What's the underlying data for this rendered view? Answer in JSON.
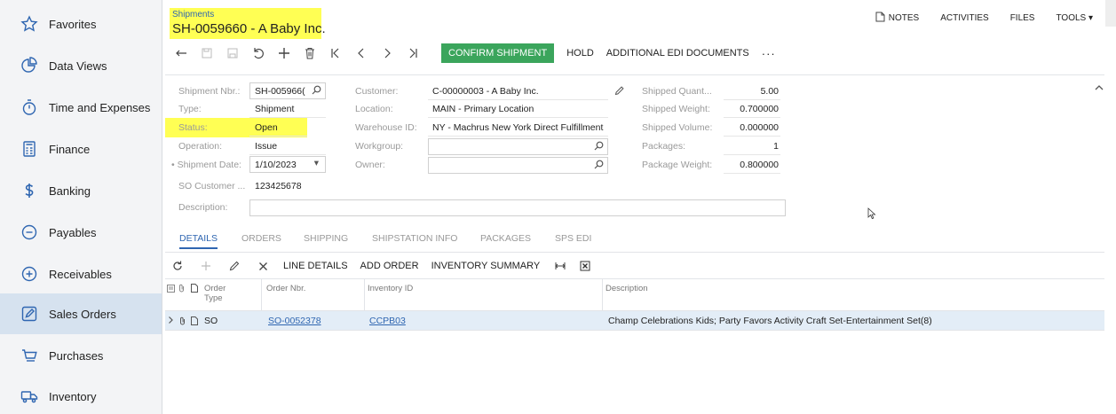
{
  "sidebar": {
    "items": [
      {
        "label": "Favorites",
        "icon": "star-icon"
      },
      {
        "label": "Data Views",
        "icon": "pie-chart-icon"
      },
      {
        "label": "Time and Expenses",
        "icon": "stopwatch-icon"
      },
      {
        "label": "Finance",
        "icon": "calculator-icon"
      },
      {
        "label": "Banking",
        "icon": "dollar-icon"
      },
      {
        "label": "Payables",
        "icon": "minus-circle-icon"
      },
      {
        "label": "Receivables",
        "icon": "plus-circle-icon"
      },
      {
        "label": "Sales Orders",
        "icon": "pencil-square-icon"
      },
      {
        "label": "Purchases",
        "icon": "cart-icon"
      },
      {
        "label": "Inventory",
        "icon": "truck-icon"
      }
    ],
    "active": "Sales Orders"
  },
  "header": {
    "breadcrumb": "Shipments",
    "title": "SH-0059660 - A Baby Inc.",
    "actions": {
      "notes": "NOTES",
      "activities": "ACTIVITIES",
      "files": "FILES",
      "tools": "TOOLS ▾"
    }
  },
  "toolbar": {
    "confirm": "CONFIRM SHIPMENT",
    "hold": "HOLD",
    "edi": "ADDITIONAL EDI DOCUMENTS",
    "more": "···"
  },
  "form": {
    "shipment_nbr": {
      "label": "Shipment Nbr.:",
      "value": "SH-005966("
    },
    "type": {
      "label": "Type:",
      "value": "Shipment"
    },
    "status": {
      "label": "Status:",
      "value": "Open"
    },
    "operation": {
      "label": "Operation:",
      "value": "Issue"
    },
    "shipment_date": {
      "label": "• Shipment Date:",
      "value": "1/10/2023"
    },
    "so_customer": {
      "label": "SO Customer ...",
      "value": "123425678"
    },
    "description": {
      "label": "Description:",
      "value": ""
    },
    "customer": {
      "label": "Customer:",
      "value": "C-00000003 - A Baby Inc."
    },
    "location": {
      "label": "Location:",
      "value": "MAIN - Primary Location"
    },
    "warehouse": {
      "label": "Warehouse ID:",
      "value": "NY - Machrus New York Direct Fulfillment"
    },
    "workgroup": {
      "label": "Workgroup:",
      "value": ""
    },
    "owner": {
      "label": "Owner:",
      "value": ""
    },
    "shipped_qty": {
      "label": "Shipped Quant...",
      "value": "5.00"
    },
    "shipped_weight": {
      "label": "Shipped Weight:",
      "value": "0.700000"
    },
    "shipped_volume": {
      "label": "Shipped Volume:",
      "value": "0.000000"
    },
    "packages": {
      "label": "Packages:",
      "value": "1"
    },
    "package_weight": {
      "label": "Package Weight:",
      "value": "0.800000"
    }
  },
  "tabs": [
    "DETAILS",
    "ORDERS",
    "SHIPPING",
    "SHIPSTATION INFO",
    "PACKAGES",
    "SPS EDI"
  ],
  "grid_toolbar": {
    "line_details": "LINE DETAILS",
    "add_order": "ADD ORDER",
    "inventory_summary": "INVENTORY SUMMARY"
  },
  "grid": {
    "columns": {
      "order_type": "Order Type",
      "order_nbr": "Order Nbr.",
      "inventory_id": "Inventory ID",
      "description": "Description"
    },
    "rows": [
      {
        "order_type": "SO",
        "order_nbr": "SO-0052378",
        "inventory_id": "CCPB03",
        "description": "Champ Celebrations Kids; Party Favors Activity Craft Set-Entertainment Set(8)"
      }
    ]
  },
  "colors": {
    "accent": "#2f66b1",
    "confirm": "#3ba55c",
    "highlight": "#ffff54",
    "row_selected": "#e3edf7"
  }
}
